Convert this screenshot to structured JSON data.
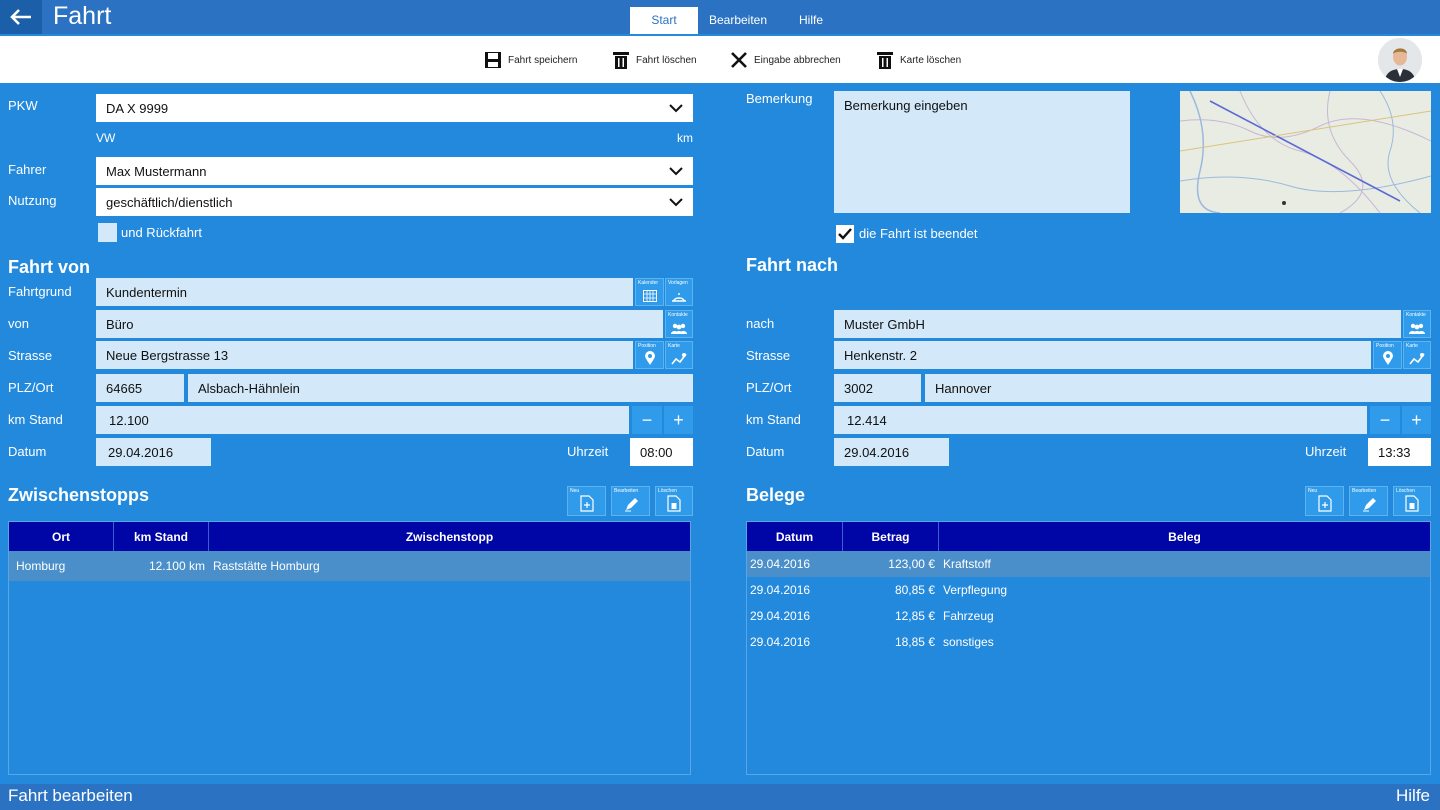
{
  "app": {
    "title": "Fahrt",
    "status_left": "Fahrt bearbeiten",
    "status_right": "Hilfe"
  },
  "menu": {
    "tabs": [
      "Start",
      "Bearbeiten",
      "Hilfe"
    ]
  },
  "toolbar": {
    "save": "Fahrt speichern",
    "delete": "Fahrt löschen",
    "cancel": "Eingabe abbrechen",
    "clear_map": "Karte löschen"
  },
  "form": {
    "pkw_label": "PKW",
    "pkw_value": "DA X 9999",
    "pkw_brand": "VW",
    "pkw_unit": "km",
    "fahrer_label": "Fahrer",
    "fahrer_value": "Max Mustermann",
    "nutzung_label": "Nutzung",
    "nutzung_value": "geschäftlich/dienstlich",
    "rueckfahrt_label": "und Rückfahrt",
    "bemerkung_label": "Bemerkung",
    "bemerkung_placeholder": "Bemerkung eingeben",
    "beendet_label": "die Fahrt ist beendet"
  },
  "von": {
    "heading": "Fahrt von",
    "fahrtgrund_label": "Fahrtgrund",
    "fahrtgrund_value": "Kundentermin",
    "kalender_cap": "Kalender",
    "vorlagen_cap": "Vorlagen",
    "von_label": "von",
    "von_value": "Büro",
    "kontakte_cap": "Kontakte",
    "strasse_label": "Strasse",
    "strasse_value": "Neue Bergstrasse 13",
    "position_cap": "Position",
    "karte_cap": "Karte",
    "plz_label": "PLZ/Ort",
    "plz_value": "64665",
    "ort_value": "Alsbach-Hähnlein",
    "km_label": "km Stand",
    "km_value": "12.100",
    "datum_label": "Datum",
    "datum_value": "29.04.2016",
    "uhrzeit_label": "Uhrzeit",
    "uhrzeit_value": "08:00",
    "minus": "−",
    "plus": "+"
  },
  "nach": {
    "heading": "Fahrt nach",
    "nach_label": "nach",
    "nach_value": "Muster GmbH",
    "kontakte_cap": "Kontakte",
    "strasse_label": "Strasse",
    "strasse_value": "Henkenstr. 2",
    "position_cap": "Position",
    "karte_cap": "Karte",
    "plz_label": "PLZ/Ort",
    "plz_value": "3002",
    "ort_value": "Hannover",
    "km_label": "km Stand",
    "km_value": "12.414",
    "datum_label": "Datum",
    "datum_value": "29.04.2016",
    "uhrzeit_label": "Uhrzeit",
    "uhrzeit_value": "13:33",
    "minus": "−",
    "plus": "+"
  },
  "zwischenstopps": {
    "heading": "Zwischenstopps",
    "btn_neu": "Neu",
    "btn_bearbeiten": "Bearbeiten",
    "btn_loeschen": "Löschen",
    "columns": [
      "Ort",
      "km Stand",
      "Zwischenstopp"
    ],
    "rows": [
      {
        "ort": "Homburg",
        "km": "12.100 km",
        "stopp": "Raststätte Homburg"
      }
    ]
  },
  "belege": {
    "heading": "Belege",
    "btn_neu": "Neu",
    "btn_bearbeiten": "Bearbeiten",
    "btn_loeschen": "Löschen",
    "columns": [
      "Datum",
      "Betrag",
      "Beleg"
    ],
    "rows": [
      {
        "datum": "29.04.2016",
        "betrag": "123,00 €",
        "beleg": "Kraftstoff"
      },
      {
        "datum": "29.04.2016",
        "betrag": "80,85 €",
        "beleg": "Verpflegung"
      },
      {
        "datum": "29.04.2016",
        "betrag": "12,85 €",
        "beleg": "Fahrzeug"
      },
      {
        "datum": "29.04.2016",
        "betrag": "18,85 €",
        "beleg": "sonstiges"
      }
    ]
  },
  "colors": {
    "background": "#2389dd",
    "titlebar": "#2b73c2",
    "table_header": "#0005a6",
    "field": "#d3e8f8"
  }
}
